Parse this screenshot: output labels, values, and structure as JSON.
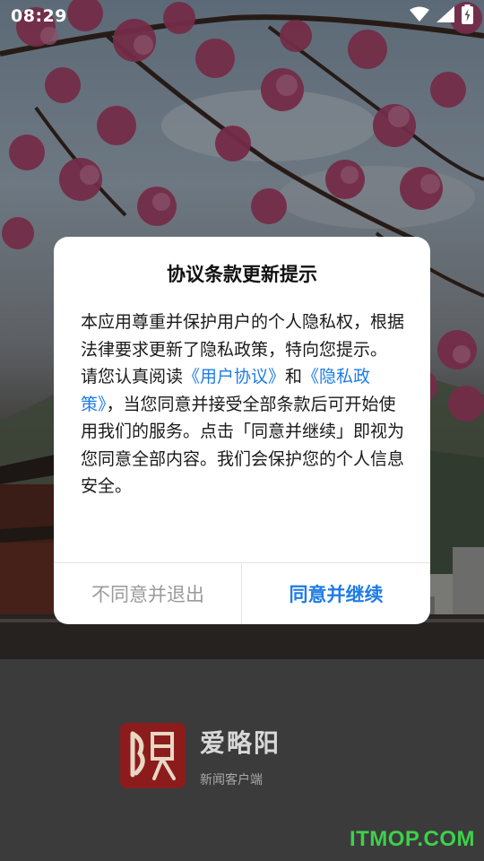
{
  "status_bar": {
    "time": "08:29",
    "icons": [
      "wifi-icon",
      "signal-icon",
      "battery-charging-icon"
    ]
  },
  "dialog": {
    "title": "协议条款更新提示",
    "paragraph1": "本应用尊重并保护用户的个人隐私权，根据法律要求更新了隐私政策，特向您提示。",
    "paragraph2_prefix": "请您认真阅读",
    "user_agreement_link": "《用户协议》",
    "and_text": "和",
    "privacy_policy_link": "《隐私政策》",
    "paragraph2_suffix": "，当您同意并接受全部条款后可开始使用我们的服务。点击「同意并继续」即视为您同意全部内容。我们会保护您的个人信息安全。",
    "disagree_label": "不同意并退出",
    "agree_label": "同意并继续"
  },
  "brand": {
    "name": "爱略阳",
    "subtitle": "新闻客户端"
  },
  "watermark": "ITMOP.COM",
  "colors": {
    "link": "#1e7ce6",
    "agree_button": "#1e7ce6",
    "disagree_button": "#9a9a9a",
    "logo_bg": "#8c1c1c",
    "watermark": "#3dd14a"
  }
}
